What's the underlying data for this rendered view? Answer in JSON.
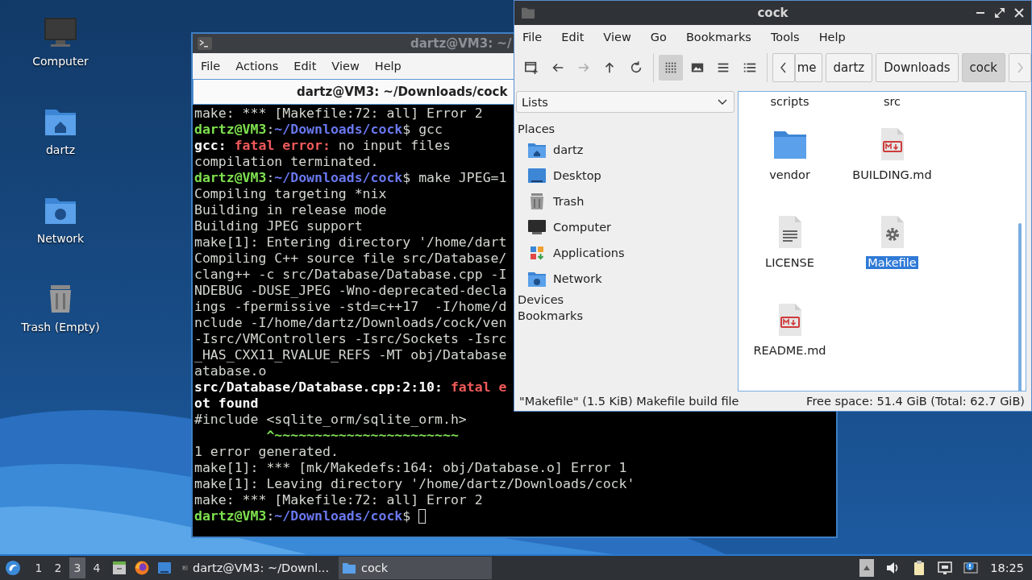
{
  "desktop_icons": [
    {
      "label": "Computer",
      "kind": "computer"
    },
    {
      "label": "dartz",
      "kind": "home"
    },
    {
      "label": "Network",
      "kind": "network"
    },
    {
      "label": "Trash (Empty)",
      "kind": "trash"
    }
  ],
  "terminal": {
    "title": "dartz@VM3: ~/",
    "menu": [
      "File",
      "Actions",
      "Edit",
      "View",
      "Help"
    ],
    "tab_title": "dartz@VM3: ~/Downloads/cock",
    "cursor": true,
    "lines": [
      [
        {
          "text": "make: *** [Makefile:72: all] Error 2",
          "kind": "plain"
        }
      ],
      [
        {
          "text": "dartz@VM3",
          "kind": "user"
        },
        {
          "text": ":",
          "kind": "plain"
        },
        {
          "text": "~/Downloads/cock",
          "kind": "path"
        },
        {
          "text": "$ gcc",
          "kind": "plain"
        }
      ],
      [
        {
          "text": "gcc: ",
          "kind": "bold"
        },
        {
          "text": "fatal error:",
          "kind": "error"
        },
        {
          "text": " no input files",
          "kind": "plain"
        }
      ],
      [
        {
          "text": "compilation terminated.",
          "kind": "plain"
        }
      ],
      [
        {
          "text": "dartz@VM3",
          "kind": "user"
        },
        {
          "text": ":",
          "kind": "plain"
        },
        {
          "text": "~/Downloads/cock",
          "kind": "path"
        },
        {
          "text": "$ make JPEG=1",
          "kind": "plain"
        }
      ],
      [
        {
          "text": "Compiling targeting *nix",
          "kind": "plain"
        }
      ],
      [
        {
          "text": "Building in release mode",
          "kind": "plain"
        }
      ],
      [
        {
          "text": "Building JPEG support",
          "kind": "plain"
        }
      ],
      [
        {
          "text": "make[1]: Entering directory '/home/dart",
          "kind": "plain"
        }
      ],
      [
        {
          "text": "Compiling C++ source file src/Database/",
          "kind": "plain"
        }
      ],
      [
        {
          "text": "clang++ -c src/Database/Database.cpp -I",
          "kind": "plain"
        }
      ],
      [
        {
          "text": "NDEBUG -DUSE_JPEG -Wno-deprecated-decla",
          "kind": "plain"
        }
      ],
      [
        {
          "text": "ings -fpermissive -std=c++17  -I/home/d",
          "kind": "plain"
        }
      ],
      [
        {
          "text": "nclude -I/home/dartz/Downloads/cock/ven",
          "kind": "plain"
        }
      ],
      [
        {
          "text": "-Isrc/VMControllers -Isrc/Sockets -Isrc",
          "kind": "plain"
        }
      ],
      [
        {
          "text": "_HAS_CXX11_RVALUE_REFS -MT obj/Database",
          "kind": "plain"
        }
      ],
      [
        {
          "text": "atabase.o",
          "kind": "plain"
        }
      ],
      [
        {
          "text": "src/Database/Database.cpp:2:10: ",
          "kind": "bold"
        },
        {
          "text": "fatal e",
          "kind": "error"
        }
      ],
      [
        {
          "text": "ot found",
          "kind": "bold"
        }
      ],
      [
        {
          "text": "#include <sqlite_orm/sqlite_orm.h>",
          "kind": "plain"
        }
      ],
      [
        {
          "text": "         ^~~~~~~~~~~~~~~~~~~~~~~~",
          "kind": "caret"
        }
      ],
      [
        {
          "text": "1 error generated.",
          "kind": "plain"
        }
      ],
      [
        {
          "text": "make[1]: *** [mk/Makedefs:164: obj/Database.o] Error 1",
          "kind": "plain"
        }
      ],
      [
        {
          "text": "make[1]: Leaving directory '/home/dartz/Downloads/cock'",
          "kind": "plain"
        }
      ],
      [
        {
          "text": "make: *** [Makefile:72: all] Error 2",
          "kind": "plain"
        }
      ],
      [
        {
          "text": "dartz@VM3",
          "kind": "user"
        },
        {
          "text": ":",
          "kind": "plain"
        },
        {
          "text": "~/Downloads/cock",
          "kind": "path"
        },
        {
          "text": "$ ",
          "kind": "plain"
        }
      ]
    ]
  },
  "file_manager": {
    "title": "cock",
    "menu": [
      "File",
      "Edit",
      "View",
      "Go",
      "Bookmarks",
      "Tools",
      "Help"
    ],
    "nav": [
      {
        "kind": "new-tab",
        "disabled": false
      },
      {
        "kind": "back",
        "disabled": false
      },
      {
        "kind": "forward",
        "disabled": true
      },
      {
        "kind": "up",
        "disabled": false
      },
      {
        "kind": "reload",
        "disabled": false
      }
    ],
    "view_modes": [
      {
        "kind": "icons",
        "selected": true
      },
      {
        "kind": "thumbnails",
        "selected": false
      },
      {
        "kind": "compact",
        "selected": false
      },
      {
        "kind": "details",
        "selected": false
      }
    ],
    "path": {
      "scroll_back_disabled": false,
      "scroll_forward_disabled": true,
      "crumbs": [
        {
          "label": "me",
          "selected": false
        },
        {
          "label": "dartz",
          "selected": false
        },
        {
          "label": "Downloads",
          "selected": false
        },
        {
          "label": "cock",
          "selected": true
        }
      ]
    },
    "side_panel": {
      "mode": "Lists",
      "sections": [
        {
          "heading": "Places",
          "items": [
            {
              "label": "dartz",
              "kind": "home"
            },
            {
              "label": "Desktop",
              "kind": "desktop"
            },
            {
              "label": "Trash",
              "kind": "trash"
            },
            {
              "label": "Computer",
              "kind": "computer"
            },
            {
              "label": "Applications",
              "kind": "applications"
            },
            {
              "label": "Network",
              "kind": "network"
            }
          ]
        },
        {
          "heading": "Devices"
        },
        {
          "heading": "Bookmarks"
        }
      ]
    },
    "files": [
      {
        "name": "scripts",
        "kind": "cut",
        "selected": false
      },
      {
        "name": "src",
        "kind": "cut",
        "selected": false
      },
      {
        "name": "vendor",
        "kind": "folder",
        "selected": false
      },
      {
        "name": "BUILDING.md",
        "kind": "markdown",
        "selected": false
      },
      {
        "name": "LICENSE",
        "kind": "text",
        "selected": false
      },
      {
        "name": "Makefile",
        "kind": "makefile",
        "selected": true
      },
      {
        "name": "README.md",
        "kind": "markdown",
        "selected": false
      }
    ],
    "status": {
      "selection": "\"Makefile\" (1.5 KiB) Makefile build file",
      "free_space": "Free space: 51.4 GiB (Total: 62.7 GiB)"
    }
  },
  "taskbar": {
    "workspaces": [
      {
        "label": "1",
        "selected": false
      },
      {
        "label": "2",
        "selected": false
      },
      {
        "label": "3",
        "selected": true
      },
      {
        "label": "4",
        "selected": false
      }
    ],
    "launchers": [
      {
        "kind": "file-manager"
      },
      {
        "kind": "browser"
      },
      {
        "kind": "desktop"
      }
    ],
    "tasks": [
      {
        "label": "dartz@VM3: ~/Downl...",
        "kind": "terminal",
        "active": false
      },
      {
        "label": "cock",
        "kind": "folder",
        "active": true
      }
    ],
    "tray": [
      {
        "kind": "up"
      },
      {
        "kind": "volume"
      },
      {
        "kind": "clipboard"
      },
      {
        "kind": "network"
      },
      {
        "kind": "notification"
      }
    ],
    "clock": "18:25"
  }
}
